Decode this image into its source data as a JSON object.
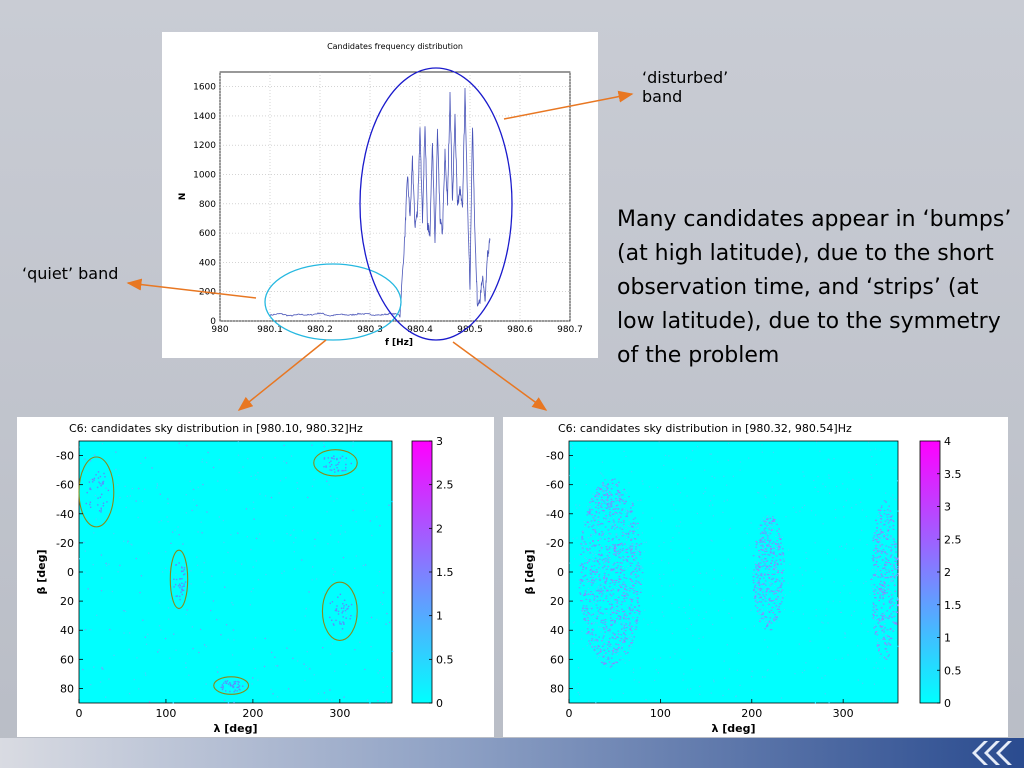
{
  "slide": {
    "quiet_label": "‘quiet’ band",
    "disturbed_label": "‘disturbed’\nband",
    "main_text": "Many candidates appear in ‘bumps’ (at high latitude), due to the short observation time, and ‘strips’ (at low latitude), due to the symmetry of the problem"
  },
  "colors": {
    "arrow": "#e87722",
    "ellipse_quiet": "#26b8e0",
    "ellipse_disturbed": "#1a1acc",
    "sky_circle": "#8a8a18",
    "series_line": "#4a55b8"
  },
  "chart_data": [
    {
      "type": "line",
      "title": "Candidates frequency distribution",
      "xlabel": "f [Hz]",
      "ylabel": "N",
      "xlim": [
        980,
        980.7
      ],
      "ylim": [
        0,
        1700
      ],
      "grid": true,
      "xticks": [
        "980",
        "980.1",
        "980.2",
        "980.3",
        "980.4",
        "980.5",
        "980.6",
        "980.7"
      ],
      "yticks": [
        "0",
        "200",
        "400",
        "600",
        "800",
        "1000",
        "1200",
        "1400",
        "1600"
      ],
      "series": [
        {
          "x": [
            980.1,
            980.12,
            980.14,
            980.16,
            980.18,
            980.2,
            980.22,
            980.24,
            980.26,
            980.28,
            980.3,
            980.32,
            980.34,
            980.36,
            980.37,
            980.375,
            980.38,
            980.385,
            980.39,
            980.395,
            980.4,
            980.405,
            980.41,
            980.415,
            980.42,
            980.425,
            980.43,
            980.435,
            980.44,
            980.445,
            980.45,
            980.455,
            980.46,
            980.465,
            980.47,
            980.475,
            980.48,
            980.485,
            980.49,
            980.495,
            980.5,
            980.505,
            980.51,
            980.515,
            980.52,
            980.525,
            980.53,
            980.535,
            980.54
          ],
          "y": [
            40,
            50,
            35,
            45,
            40,
            55,
            35,
            45,
            40,
            50,
            45,
            40,
            50,
            45,
            600,
            1000,
            700,
            1100,
            650,
            750,
            1300,
            700,
            1350,
            650,
            600,
            1250,
            500,
            1300,
            700,
            600,
            1150,
            800,
            1550,
            800,
            1400,
            780,
            900,
            750,
            1560,
            850,
            200,
            1350,
            600,
            100,
            150,
            300,
            120,
            450,
            550
          ]
        }
      ]
    },
    {
      "type": "heatmap",
      "title": "C6: candidates sky distribution in [980.10, 980.32]Hz",
      "xlabel": "λ [deg]",
      "ylabel": "β [deg]",
      "xlim": [
        0,
        360
      ],
      "ylim": [
        -90,
        90
      ],
      "xticks": [
        "0",
        "100",
        "200",
        "300"
      ],
      "yticks": [
        "-80",
        "-60",
        "-40",
        "-20",
        "0",
        "20",
        "40",
        "60",
        "80"
      ],
      "colorbar_ticks": [
        "0",
        "0.5",
        "1",
        "1.5",
        "2",
        "2.5",
        "3"
      ],
      "colorbar_range": [
        0,
        3
      ],
      "circled_regions": [
        {
          "lambda": 20,
          "beta": -55,
          "d_lambda": 20,
          "d_beta": 24
        },
        {
          "lambda": 115,
          "beta": 5,
          "d_lambda": 10,
          "d_beta": 20
        },
        {
          "lambda": 295,
          "beta": -75,
          "d_lambda": 25,
          "d_beta": 9
        },
        {
          "lambda": 300,
          "beta": 27,
          "d_lambda": 20,
          "d_beta": 20
        },
        {
          "lambda": 175,
          "beta": 78,
          "d_lambda": 20,
          "d_beta": 6
        }
      ]
    },
    {
      "type": "heatmap",
      "title": "C6: candidates sky distribution in [980.32, 980.54]Hz",
      "xlabel": "λ [deg]",
      "ylabel": "β [deg]",
      "xlim": [
        0,
        360
      ],
      "ylim": [
        -90,
        90
      ],
      "xticks": [
        "0",
        "100",
        "200",
        "300"
      ],
      "yticks": [
        "-80",
        "-60",
        "-40",
        "-20",
        "0",
        "20",
        "40",
        "60",
        "80"
      ],
      "colorbar_ticks": [
        "0",
        "0.5",
        "1",
        "1.5",
        "2",
        "2.5",
        "3",
        "3.5",
        "4"
      ],
      "colorbar_range": [
        0,
        4
      ],
      "bands": [
        {
          "lambda_from": 10,
          "lambda_to": 80,
          "beta_from": -65,
          "beta_to": 65,
          "level": 2.5
        },
        {
          "lambda_from": 200,
          "lambda_to": 235,
          "beta_from": -40,
          "beta_to": 40,
          "level": 2
        },
        {
          "lambda_from": 330,
          "lambda_to": 360,
          "beta_from": -50,
          "beta_to": 60,
          "level": 2
        }
      ]
    }
  ]
}
